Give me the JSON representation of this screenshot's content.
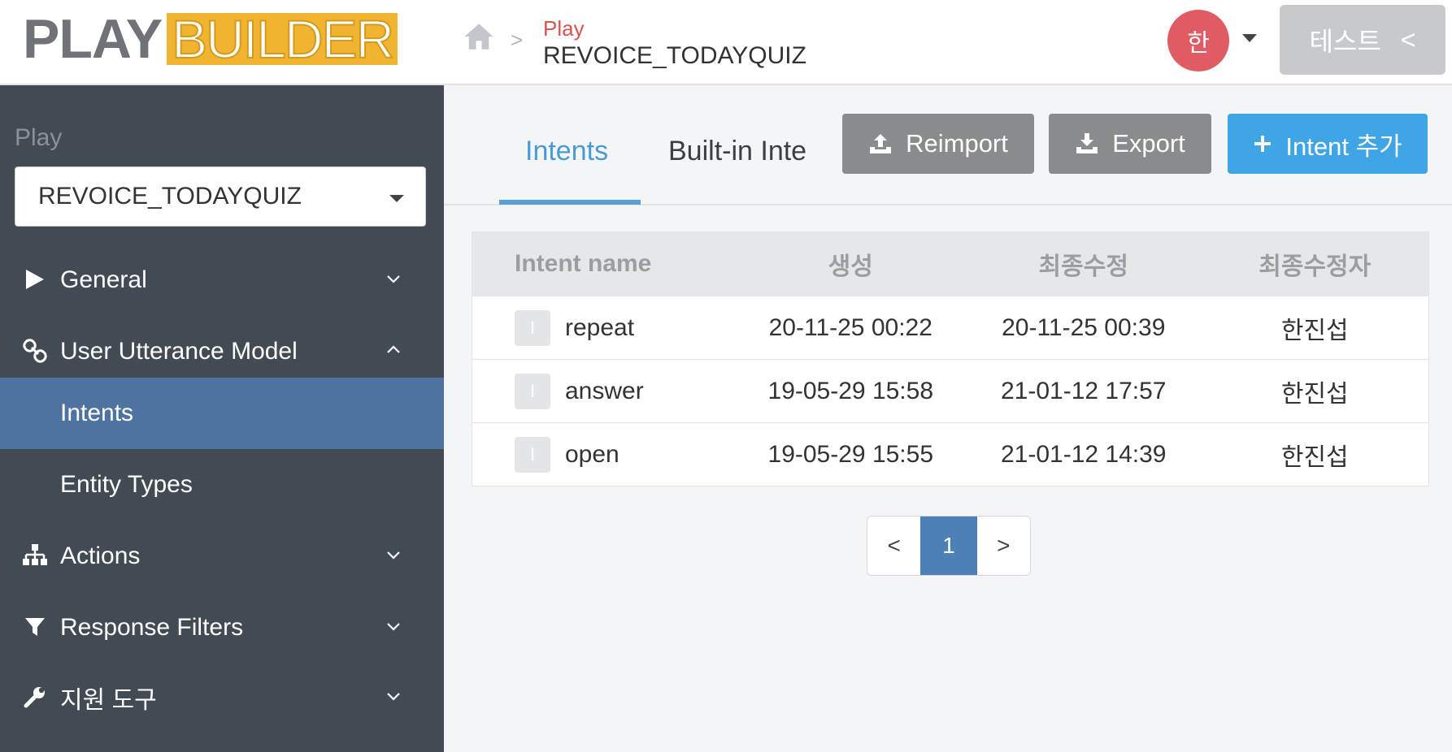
{
  "header": {
    "logo_left": "PLAY",
    "logo_right": "BUILDER",
    "breadcrumb_sep": ">",
    "breadcrumb_top": "Play",
    "breadcrumb_main": "REVOICE_TODAYQUIZ",
    "avatar_initial": "한",
    "test_button": "테스트",
    "test_button_chevron": "<"
  },
  "sidebar": {
    "section_label": "Play",
    "play_select_value": "REVOICE_TODAYQUIZ",
    "items": [
      {
        "label": "General",
        "icon": "play-triangle-icon",
        "expanded": false
      },
      {
        "label": "User Utterance Model",
        "icon": "link-icon",
        "expanded": true
      },
      {
        "label": "Intents",
        "sub": true,
        "active": true
      },
      {
        "label": "Entity Types",
        "sub": true,
        "active": false
      },
      {
        "label": "Actions",
        "icon": "sitemap-icon",
        "expanded": false
      },
      {
        "label": "Response Filters",
        "icon": "filter-icon",
        "expanded": false
      },
      {
        "label": "지원 도구",
        "icon": "wrench-icon",
        "expanded": false
      }
    ]
  },
  "main": {
    "tabs": [
      {
        "label": "Intents",
        "active": true
      },
      {
        "label": "Built-in Inte",
        "active": false
      }
    ],
    "buttons": {
      "reimport": "Reimport",
      "export": "Export",
      "add_intent": "Intent 추가"
    },
    "table": {
      "headers": [
        "Intent name",
        "생성",
        "최종수정",
        "최종수정자"
      ],
      "rows": [
        {
          "badge": "I",
          "name": "repeat",
          "created": "20-11-25 00:22",
          "modified": "20-11-25 00:39",
          "modifier": "한진섭"
        },
        {
          "badge": "I",
          "name": "answer",
          "created": "19-05-29 15:58",
          "modified": "21-01-12 17:57",
          "modifier": "한진섭"
        },
        {
          "badge": "I",
          "name": "open",
          "created": "19-05-29 15:55",
          "modified": "21-01-12 14:39",
          "modifier": "한진섭"
        }
      ]
    },
    "pagination": {
      "prev": "<",
      "current": "1",
      "next": ">"
    }
  },
  "colors": {
    "accent_blue": "#3fa5e4",
    "sidebar_bg": "#424a54",
    "sidebar_active": "#4e73a0",
    "logo_yellow": "#f0b431",
    "avatar_red": "#e05b63",
    "breadcrumb_red": "#d9534f"
  }
}
